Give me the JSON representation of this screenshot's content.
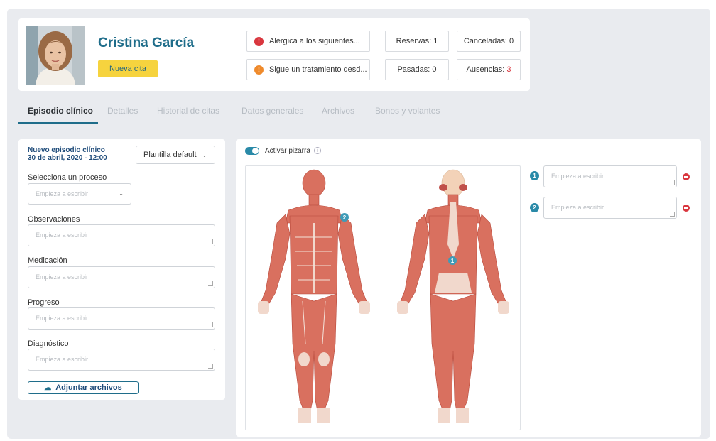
{
  "patient": {
    "name": "Cristina García",
    "new_appointment_label": "Nueva cita"
  },
  "alerts": [
    {
      "text": "Alérgica a los siguientes...",
      "icon": "exclamation-icon",
      "color": "#d9363e",
      "glyph": "!"
    },
    {
      "text": "Sigue un tratamiento desd...",
      "icon": "exclamation-icon",
      "color": "#ef8a2b",
      "glyph": "!"
    }
  ],
  "stats": {
    "reservas": "Reservas: 1",
    "canceladas": "Canceladas: 0",
    "pasadas": "Pasadas: 0",
    "ausencias_label": "Ausencias: ",
    "ausencias_value": "3",
    "ausencias_color": "#d9363e"
  },
  "tabs": [
    {
      "label": "Episodio clínico",
      "active": true
    },
    {
      "label": "Detalles",
      "active": false
    },
    {
      "label": "Historial de citas",
      "active": false
    },
    {
      "label": "Datos generales",
      "active": false
    },
    {
      "label": "Archivos",
      "active": false
    },
    {
      "label": "Bonos y volantes",
      "active": false
    }
  ],
  "episode": {
    "title": "Nuevo episodio clínico",
    "date": "30 de abril, 2020 - 12:00",
    "template_label": "Plantilla default",
    "process_label": "Selecciona un proceso",
    "process_placeholder": "Empieza a escribir",
    "fields": [
      {
        "label": "Observaciones",
        "placeholder": "Empieza a escribir"
      },
      {
        "label": "Medicación",
        "placeholder": "Empieza a escribir"
      },
      {
        "label": "Progreso",
        "placeholder": "Empieza a escribir"
      },
      {
        "label": "Diagnóstico",
        "placeholder": "Empieza a escribir"
      }
    ],
    "attach_label": "Adjuntar archivos"
  },
  "whiteboard": {
    "toggle_label": "Activar pizarra",
    "toggle_on": true,
    "pins": [
      "1",
      "2"
    ],
    "notes": [
      {
        "number": "1",
        "placeholder": "Empieza a escribir"
      },
      {
        "number": "2",
        "placeholder": "Empieza a escribir"
      }
    ]
  },
  "colors": {
    "accent": "#1f6d8a",
    "button_yellow": "#f6d33e",
    "muscle": "#d9705f",
    "danger": "#d9363e"
  }
}
